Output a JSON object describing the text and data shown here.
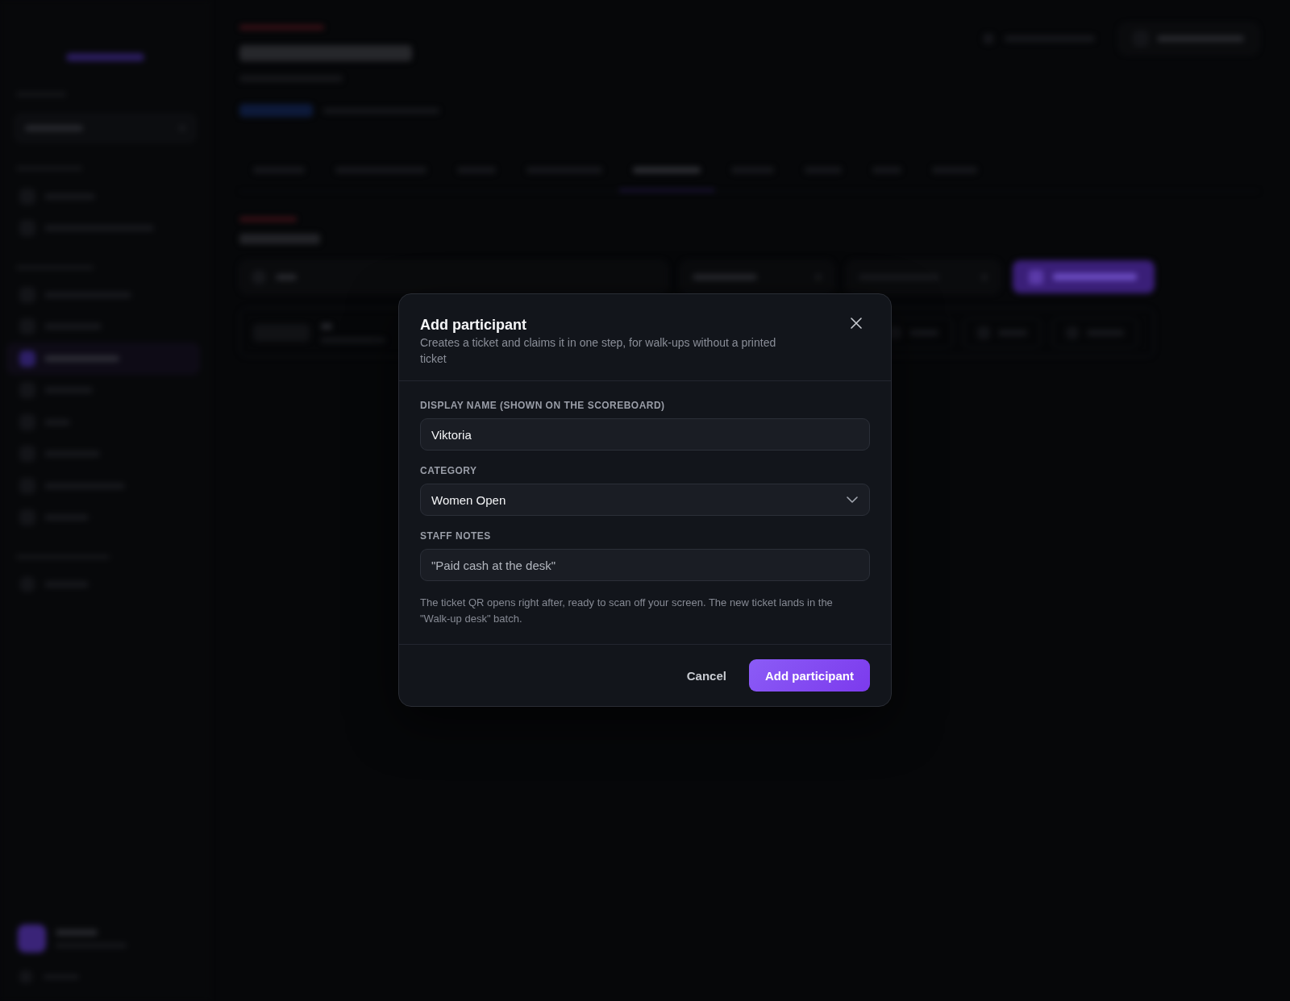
{
  "dialog": {
    "title": "Add participant",
    "subtitle": "Creates a ticket and claims it in one step, for walk-ups without a printed ticket",
    "fields": [
      {
        "kind": "text",
        "label": "DISPLAY NAME (SHOWN ON THE SCOREBOARD)",
        "value": "Viktoria"
      },
      {
        "kind": "select",
        "label": "CATEGORY",
        "value": "Women Open"
      },
      {
        "kind": "text",
        "label": "STAFF NOTES",
        "placeholder": "\"Paid cash at the desk\""
      }
    ],
    "help_text": "The ticket QR opens right after, ready to scan off your screen. The new ticket lands in the \"Walk-up desk\" batch.",
    "buttons": [
      {
        "kind": "secondary",
        "label": "Cancel"
      },
      {
        "kind": "primary",
        "label": "Add participant"
      }
    ]
  }
}
